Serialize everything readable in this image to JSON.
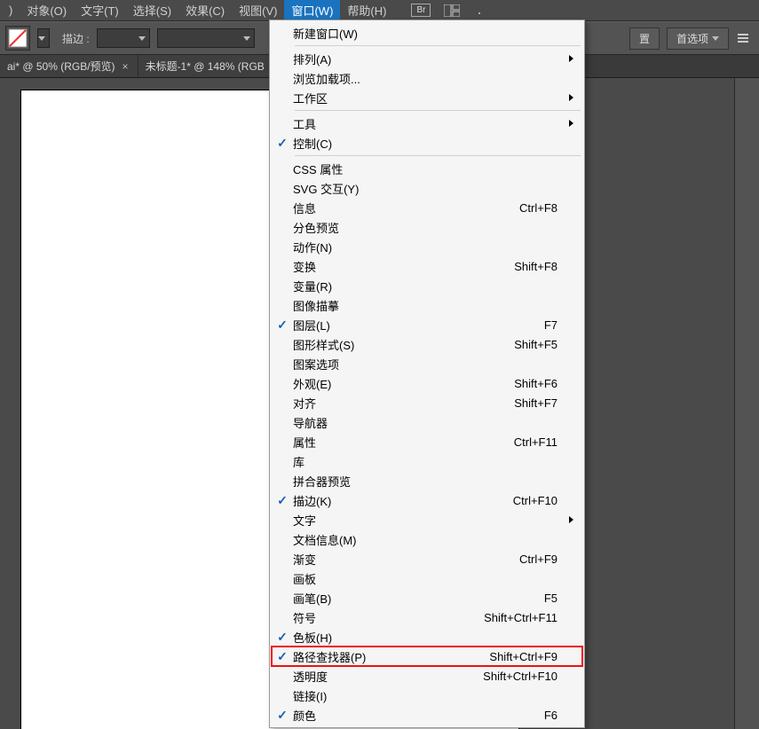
{
  "menubar": {
    "items": [
      {
        "label": ")"
      },
      {
        "label": "对象(O)"
      },
      {
        "label": "文字(T)"
      },
      {
        "label": "选择(S)"
      },
      {
        "label": "效果(C)"
      },
      {
        "label": "视图(V)"
      },
      {
        "label": "窗口(W)"
      },
      {
        "label": "帮助(H)"
      }
    ],
    "active_index": 6
  },
  "toolbar": {
    "stroke_label": "描边 :",
    "right_buttons": {
      "settings": "置",
      "prefs": "首选项"
    }
  },
  "tabs": [
    {
      "label": "ai* @ 50% (RGB/预览)"
    },
    {
      "label": "未标题-1* @ 148% (RGB"
    }
  ],
  "menu": {
    "groups": [
      [
        {
          "label": "新建窗口(W)",
          "checked": false,
          "shortcut": "",
          "submenu": false
        }
      ],
      [
        {
          "label": "排列(A)",
          "checked": false,
          "shortcut": "",
          "submenu": true
        },
        {
          "label": "浏览加载项...",
          "checked": false,
          "shortcut": "",
          "submenu": false
        },
        {
          "label": "工作区",
          "checked": false,
          "shortcut": "",
          "submenu": true
        }
      ],
      [
        {
          "label": "工具",
          "checked": false,
          "shortcut": "",
          "submenu": true
        },
        {
          "label": "控制(C)",
          "checked": true,
          "shortcut": "",
          "submenu": false
        }
      ],
      [
        {
          "label": "CSS 属性",
          "checked": false,
          "shortcut": "",
          "submenu": false
        },
        {
          "label": "SVG 交互(Y)",
          "checked": false,
          "shortcut": "",
          "submenu": false
        },
        {
          "label": "信息",
          "checked": false,
          "shortcut": "Ctrl+F8",
          "submenu": false
        },
        {
          "label": "分色预览",
          "checked": false,
          "shortcut": "",
          "submenu": false
        },
        {
          "label": "动作(N)",
          "checked": false,
          "shortcut": "",
          "submenu": false
        },
        {
          "label": "变换",
          "checked": false,
          "shortcut": "Shift+F8",
          "submenu": false
        },
        {
          "label": "变量(R)",
          "checked": false,
          "shortcut": "",
          "submenu": false
        },
        {
          "label": "图像描摹",
          "checked": false,
          "shortcut": "",
          "submenu": false
        },
        {
          "label": "图层(L)",
          "checked": true,
          "shortcut": "F7",
          "submenu": false
        },
        {
          "label": "图形样式(S)",
          "checked": false,
          "shortcut": "Shift+F5",
          "submenu": false
        },
        {
          "label": "图案选项",
          "checked": false,
          "shortcut": "",
          "submenu": false
        },
        {
          "label": "外观(E)",
          "checked": false,
          "shortcut": "Shift+F6",
          "submenu": false
        },
        {
          "label": "对齐",
          "checked": false,
          "shortcut": "Shift+F7",
          "submenu": false
        },
        {
          "label": "导航器",
          "checked": false,
          "shortcut": "",
          "submenu": false
        },
        {
          "label": "属性",
          "checked": false,
          "shortcut": "Ctrl+F11",
          "submenu": false
        },
        {
          "label": "库",
          "checked": false,
          "shortcut": "",
          "submenu": false
        },
        {
          "label": "拼合器预览",
          "checked": false,
          "shortcut": "",
          "submenu": false
        },
        {
          "label": "描边(K)",
          "checked": true,
          "shortcut": "Ctrl+F10",
          "submenu": false
        },
        {
          "label": "文字",
          "checked": false,
          "shortcut": "",
          "submenu": true
        },
        {
          "label": "文档信息(M)",
          "checked": false,
          "shortcut": "",
          "submenu": false
        },
        {
          "label": "渐变",
          "checked": false,
          "shortcut": "Ctrl+F9",
          "submenu": false
        },
        {
          "label": "画板",
          "checked": false,
          "shortcut": "",
          "submenu": false
        },
        {
          "label": "画笔(B)",
          "checked": false,
          "shortcut": "F5",
          "submenu": false
        },
        {
          "label": "符号",
          "checked": false,
          "shortcut": "Shift+Ctrl+F11",
          "submenu": false
        },
        {
          "label": "色板(H)",
          "checked": true,
          "shortcut": "",
          "submenu": false
        },
        {
          "label": "路径查找器(P)",
          "checked": true,
          "shortcut": "Shift+Ctrl+F9",
          "submenu": false,
          "highlight": true
        },
        {
          "label": "透明度",
          "checked": false,
          "shortcut": "Shift+Ctrl+F10",
          "submenu": false
        },
        {
          "label": "链接(I)",
          "checked": false,
          "shortcut": "",
          "submenu": false
        },
        {
          "label": "颜色",
          "checked": true,
          "shortcut": "F6",
          "submenu": false
        }
      ]
    ]
  }
}
